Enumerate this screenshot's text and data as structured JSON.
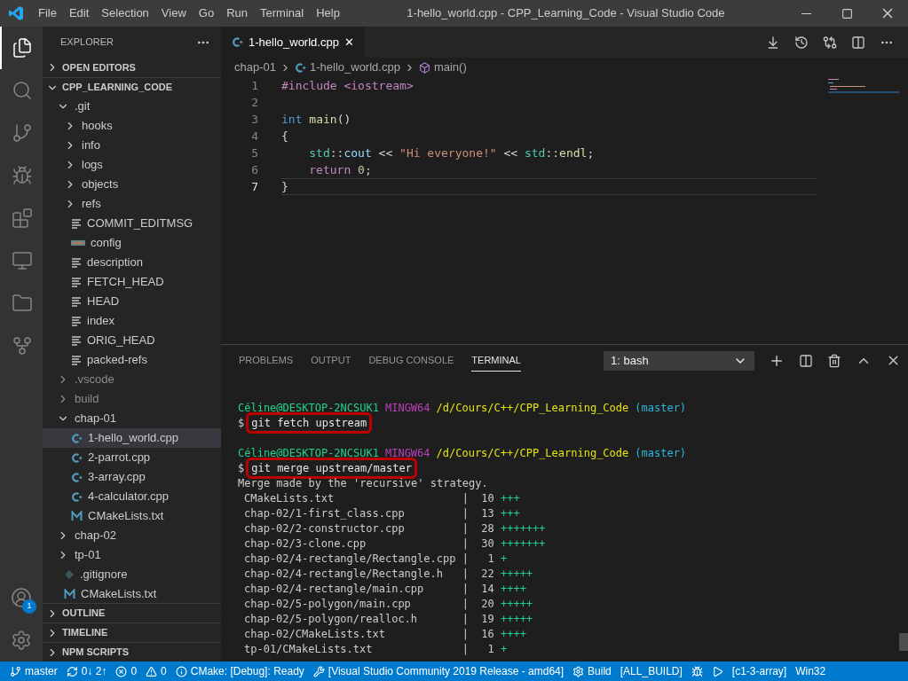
{
  "window": {
    "title": "1-hello_world.cpp - CPP_Learning_Code - Visual Studio Code"
  },
  "menu": [
    "File",
    "Edit",
    "Selection",
    "View",
    "Go",
    "Run",
    "Terminal",
    "Help"
  ],
  "activity_bar": [
    {
      "kind": "explorer",
      "selected": true
    },
    {
      "kind": "search",
      "selected": false
    },
    {
      "kind": "source-control",
      "selected": false
    },
    {
      "kind": "debug",
      "selected": false
    },
    {
      "kind": "extensions",
      "selected": false
    },
    {
      "kind": "remote",
      "selected": false
    },
    {
      "kind": "folder",
      "selected": false
    },
    {
      "kind": "git-graph",
      "selected": false
    }
  ],
  "account": {
    "badge": "1"
  },
  "sidebar": {
    "title": "EXPLORER",
    "sections_top": [
      {
        "label": "OPEN EDITORS",
        "expanded": false
      },
      {
        "label": "CPP_LEARNING_CODE",
        "expanded": true
      }
    ],
    "tree": [
      {
        "label": ".git",
        "kind": "folder",
        "expanded": true,
        "ignored": false,
        "selected": false,
        "children": [
          {
            "label": "hooks",
            "kind": "folder",
            "expanded": false,
            "ignored": false,
            "selected": false
          },
          {
            "label": "info",
            "kind": "folder",
            "expanded": false,
            "ignored": false,
            "selected": false
          },
          {
            "label": "logs",
            "kind": "folder",
            "expanded": false,
            "ignored": false,
            "selected": false
          },
          {
            "label": "objects",
            "kind": "folder",
            "expanded": false,
            "ignored": false,
            "selected": false
          },
          {
            "label": "refs",
            "kind": "folder",
            "expanded": false,
            "ignored": false,
            "selected": false
          },
          {
            "label": "COMMIT_EDITMSG",
            "kind": "text",
            "ignored": false,
            "selected": false
          },
          {
            "label": "config",
            "kind": "config",
            "ignored": false,
            "selected": false
          },
          {
            "label": "description",
            "kind": "text",
            "ignored": false,
            "selected": false
          },
          {
            "label": "FETCH_HEAD",
            "kind": "text",
            "ignored": false,
            "selected": false
          },
          {
            "label": "HEAD",
            "kind": "text",
            "ignored": false,
            "selected": false
          },
          {
            "label": "index",
            "kind": "text",
            "ignored": false,
            "selected": false
          },
          {
            "label": "ORIG_HEAD",
            "kind": "text",
            "ignored": false,
            "selected": false
          },
          {
            "label": "packed-refs",
            "kind": "text",
            "ignored": false,
            "selected": false
          }
        ]
      },
      {
        "label": ".vscode",
        "kind": "folder",
        "expanded": false,
        "ignored": true,
        "selected": false
      },
      {
        "label": "build",
        "kind": "folder",
        "expanded": false,
        "ignored": true,
        "selected": false
      },
      {
        "label": "chap-01",
        "kind": "folder",
        "expanded": true,
        "ignored": false,
        "selected": false,
        "children": [
          {
            "label": "1-hello_world.cpp",
            "kind": "cpp",
            "ignored": false,
            "selected": true
          },
          {
            "label": "2-parrot.cpp",
            "kind": "cpp",
            "ignored": false,
            "selected": false
          },
          {
            "label": "3-array.cpp",
            "kind": "cpp",
            "ignored": false,
            "selected": false
          },
          {
            "label": "4-calculator.cpp",
            "kind": "cpp",
            "ignored": false,
            "selected": false
          },
          {
            "label": "CMakeLists.txt",
            "kind": "cmake",
            "ignored": false,
            "selected": false
          }
        ]
      },
      {
        "label": "chap-02",
        "kind": "folder",
        "expanded": false,
        "ignored": false,
        "selected": false
      },
      {
        "label": "tp-01",
        "kind": "folder",
        "expanded": false,
        "ignored": false,
        "selected": false
      },
      {
        "label": ".gitignore",
        "kind": "git",
        "ignored": false,
        "selected": false
      },
      {
        "label": "CMakeLists.txt",
        "kind": "cmake",
        "ignored": false,
        "selected": false
      }
    ],
    "sections_bottom": [
      {
        "label": "OUTLINE",
        "expanded": false
      },
      {
        "label": "TIMELINE",
        "expanded": false
      },
      {
        "label": "NPM SCRIPTS",
        "expanded": false
      }
    ]
  },
  "editor": {
    "tab": {
      "label": "1-hello_world.cpp",
      "close": "✕"
    },
    "breadcrumb": [
      {
        "label": "chap-01",
        "kind": "folder"
      },
      {
        "label": "1-hello_world.cpp",
        "kind": "cpp"
      },
      {
        "label": "main()",
        "kind": "symbol"
      }
    ],
    "lines": [
      {
        "number": "1",
        "current": false,
        "indented": false,
        "tokens": [
          {
            "text": "#include <iostream>",
            "kind": "preproc"
          }
        ]
      },
      {
        "number": "2",
        "current": false
      },
      {
        "number": "3",
        "current": false,
        "indented": false,
        "tokens": [
          {
            "text": "int",
            "kind": "keyword"
          },
          {
            "text": " main",
            "kind": "func"
          },
          {
            "text": "()",
            "kind": "plain"
          }
        ]
      },
      {
        "number": "4",
        "current": false,
        "indented": false,
        "tokens": [
          {
            "text": "{",
            "kind": "plain"
          }
        ]
      },
      {
        "number": "5",
        "current": false,
        "indented": true,
        "tokens": [
          {
            "text": "std",
            "kind": "type"
          },
          {
            "text": "::",
            "kind": "plain"
          },
          {
            "text": "cout",
            "kind": "var"
          },
          {
            "text": " << ",
            "kind": "plain"
          },
          {
            "text": "\"Hi everyone!\"",
            "kind": "string"
          },
          {
            "text": " << ",
            "kind": "plain"
          },
          {
            "text": "std",
            "kind": "type"
          },
          {
            "text": "::",
            "kind": "plain"
          },
          {
            "text": "endl",
            "kind": "func"
          },
          {
            "text": ";",
            "kind": "plain"
          }
        ]
      },
      {
        "number": "6",
        "current": false,
        "indented": true,
        "tokens": [
          {
            "text": "return",
            "kind": "control"
          },
          {
            "text": " 0",
            "kind": "number"
          },
          {
            "text": ";",
            "kind": "plain"
          }
        ]
      },
      {
        "number": "7",
        "current": true,
        "indented": false,
        "tokens": [
          {
            "text": "}",
            "kind": "plain"
          }
        ]
      }
    ]
  },
  "panel": {
    "tabs": [
      {
        "label": "PROBLEMS",
        "selected": false
      },
      {
        "label": "OUTPUT",
        "selected": false
      },
      {
        "label": "DEBUG CONSOLE",
        "selected": false
      },
      {
        "label": "TERMINAL",
        "selected": true
      }
    ],
    "terminal_select": "1: bash",
    "terminal": [
      {
        "kind": "blank"
      },
      {
        "kind": "prompt",
        "user": "Céline@DESKTOP-2NCSUK1",
        "system": "MINGW64",
        "path": "/d/Cours/C++/CPP_Learning_Code",
        "branch": "(master)"
      },
      {
        "kind": "command",
        "sign": "$",
        "text": "git fetch upstream",
        "highlighted": true
      },
      {
        "kind": "blank"
      },
      {
        "kind": "prompt",
        "user": "Céline@DESKTOP-2NCSUK1",
        "system": "MINGW64",
        "path": "/d/Cours/C++/CPP_Learning_Code",
        "branch": "(master)"
      },
      {
        "kind": "command",
        "sign": "$",
        "text": "git merge upstream/master",
        "highlighted": true
      },
      {
        "kind": "output",
        "text": "Merge made by the 'recursive' strategy."
      },
      {
        "kind": "stat",
        "file": "CMakeLists.txt",
        "sep": "|",
        "count": "10",
        "graph": "+++"
      },
      {
        "kind": "stat",
        "file": "chap-02/1-first_class.cpp",
        "sep": "|",
        "count": "13",
        "graph": "+++"
      },
      {
        "kind": "stat",
        "file": "chap-02/2-constructor.cpp",
        "sep": "|",
        "count": "28",
        "graph": "+++++++"
      },
      {
        "kind": "stat",
        "file": "chap-02/3-clone.cpp",
        "sep": "|",
        "count": "30",
        "graph": "+++++++"
      },
      {
        "kind": "stat",
        "file": "chap-02/4-rectangle/Rectangle.cpp",
        "sep": "|",
        "count": "1",
        "graph": "+"
      },
      {
        "kind": "stat",
        "file": "chap-02/4-rectangle/Rectangle.h",
        "sep": "|",
        "count": "22",
        "graph": "+++++"
      },
      {
        "kind": "stat",
        "file": "chap-02/4-rectangle/main.cpp",
        "sep": "|",
        "count": "14",
        "graph": "++++"
      },
      {
        "kind": "stat",
        "file": "chap-02/5-polygon/main.cpp",
        "sep": "|",
        "count": "20",
        "graph": "+++++"
      },
      {
        "kind": "stat",
        "file": "chap-02/5-polygon/realloc.h",
        "sep": "|",
        "count": "19",
        "graph": "+++++"
      },
      {
        "kind": "stat",
        "file": "chap-02/CMakeLists.txt",
        "sep": "|",
        "count": "16",
        "graph": "++++"
      },
      {
        "kind": "stat",
        "file": "tp-01/CMakeLists.txt",
        "sep": "|",
        "count": "1",
        "graph": "+"
      }
    ]
  },
  "status_bar": [
    {
      "kind": "branch",
      "text": "master"
    },
    {
      "kind": "sync",
      "text": "0↓ 2↑"
    },
    {
      "kind": "errors",
      "text": "0"
    },
    {
      "kind": "warnings",
      "text": "0"
    },
    {
      "kind": "cmake-status",
      "text": "CMake: [Debug]: Ready"
    },
    {
      "kind": "kit",
      "text": "[Visual Studio Community 2019 Release - amd64]"
    },
    {
      "kind": "build",
      "text": "Build"
    },
    {
      "kind": "target",
      "text": "[ALL_BUILD]"
    },
    {
      "kind": "debug"
    },
    {
      "kind": "run"
    },
    {
      "kind": "target",
      "text": "[c1-3-array]"
    },
    {
      "kind": "platform",
      "text": "Win32"
    }
  ]
}
